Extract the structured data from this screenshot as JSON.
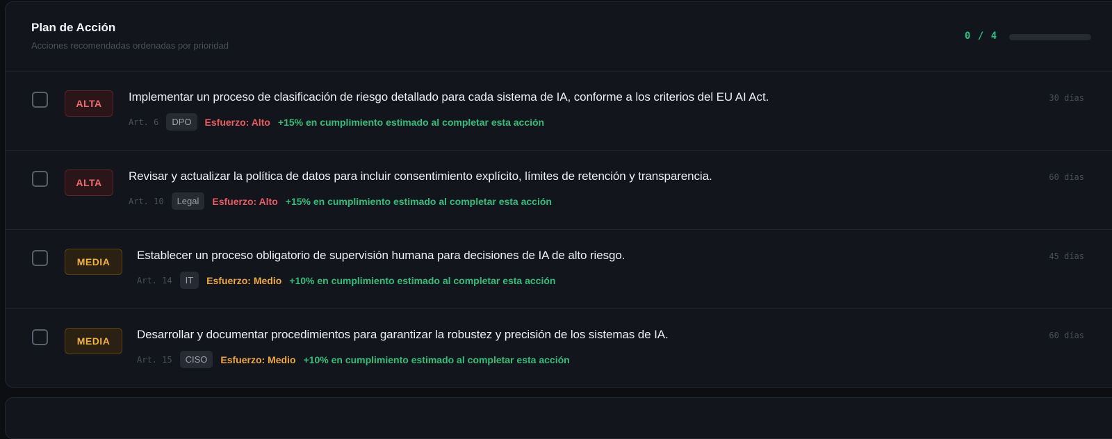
{
  "plan": {
    "title": "Plan de Acción",
    "subtitle": "Acciones recomendadas ordenadas por prioridad",
    "progress_text": "0 / 4",
    "progress_fraction": 0,
    "accent_color": "#27c084"
  },
  "actions": [
    {
      "priority": "ALTA",
      "title": "Implementar un proceso de clasificación de riesgo detallado para cada sistema de IA, conforme a los criterios del EU AI Act.",
      "article": "Art. 6",
      "owner": "DPO",
      "effort": "Esfuerzo: Alto",
      "impact": "+15% en cumplimiento estimado al completar esta acción",
      "days": "30 días",
      "checked": false
    },
    {
      "priority": "ALTA",
      "title": "Revisar y actualizar la política de datos para incluir consentimiento explícito, límites de retención y transparencia.",
      "article": "Art. 10",
      "owner": "Legal",
      "effort": "Esfuerzo: Alto",
      "impact": "+15% en cumplimiento estimado al completar esta acción",
      "days": "60 días",
      "checked": false
    },
    {
      "priority": "MEDIA",
      "title": "Establecer un proceso obligatorio de supervisión humana para decisiones de IA de alto riesgo.",
      "article": "Art. 14",
      "owner": "IT",
      "effort": "Esfuerzo: Medio",
      "impact": "+10% en cumplimiento estimado al completar esta acción",
      "days": "45 días",
      "checked": false
    },
    {
      "priority": "MEDIA",
      "title": "Desarrollar y documentar procedimientos para garantizar la robustez y precisión de los sistemas de IA.",
      "article": "Art. 15",
      "owner": "CISO",
      "effort": "Esfuerzo: Medio",
      "impact": "+10% en cumplimiento estimado al completar esta acción",
      "days": "60 días",
      "checked": false
    }
  ]
}
